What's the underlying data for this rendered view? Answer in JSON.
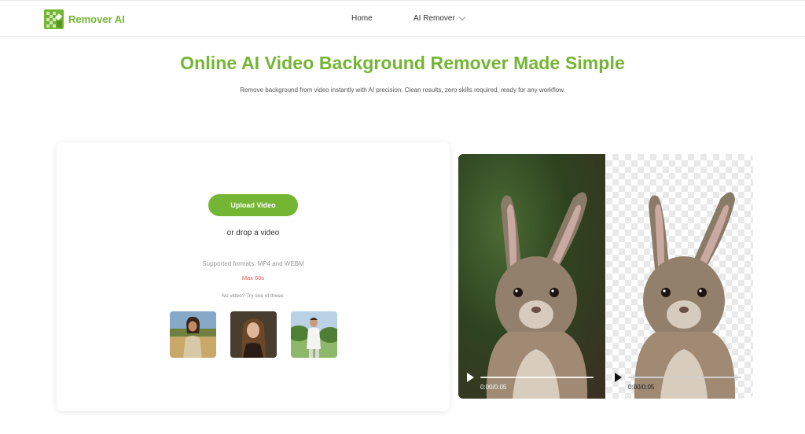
{
  "brand": {
    "name": "Remover AI",
    "color": "#74b533"
  },
  "nav": {
    "home": "Home",
    "ai_remover": "AI Remover"
  },
  "hero": {
    "title": "Online AI Video Background Remover Made Simple",
    "subtitle": "Remove background from video instantly with AI precision. Clean results, zero skills required, ready for any workflow."
  },
  "upload": {
    "button": "Upload Video",
    "drop_text": "or drop a video",
    "formats": "Supported formats: MP4 and WEBM",
    "max_length": "Max 60s",
    "try_text": "No video? Try one of these:"
  },
  "preview": {
    "original": {
      "time": "0:00/0:05"
    },
    "removed": {
      "time": "0:00/0:05"
    }
  },
  "icons": [
    "logo-icon",
    "chevron-down-icon",
    "play-icon"
  ]
}
